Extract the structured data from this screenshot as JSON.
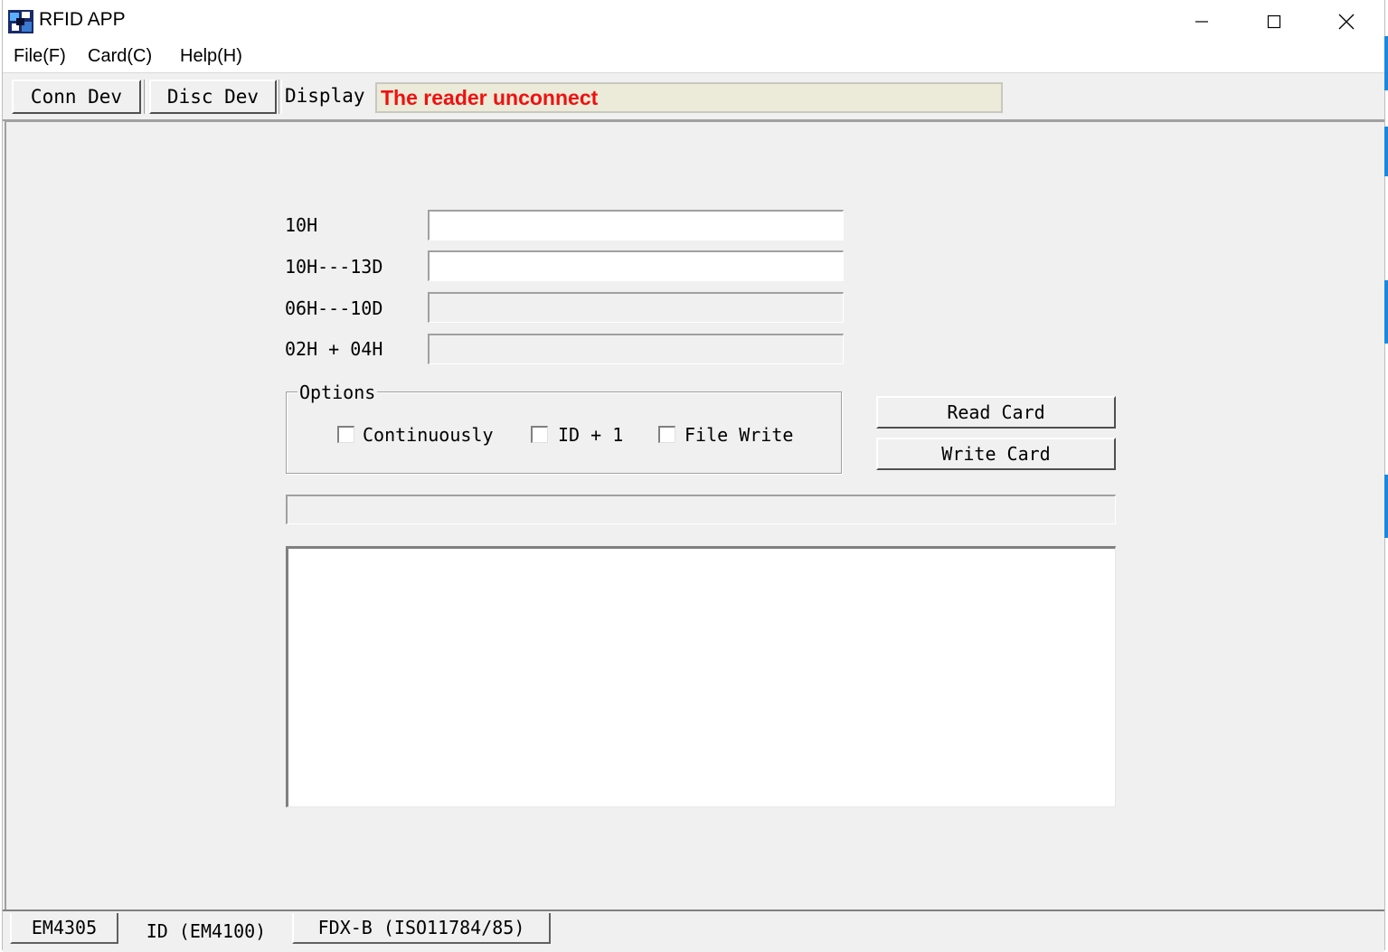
{
  "window": {
    "title": "RFID APP"
  },
  "menu": {
    "items": [
      "File(F)",
      "Card(C)",
      "Help(H)"
    ]
  },
  "toolbar": {
    "connect_label": "Conn Dev",
    "disconnect_label": "Disc Dev",
    "display_label": "Display",
    "status_text": "The reader unconnect"
  },
  "form": {
    "fields": [
      {
        "label": "10H",
        "value": ""
      },
      {
        "label": "10H---13D",
        "value": ""
      },
      {
        "label": "06H---10D",
        "value": ""
      },
      {
        "label": "02H + 04H",
        "value": ""
      }
    ],
    "options": {
      "title": "Options",
      "checkboxes": [
        {
          "label": "Continuously",
          "checked": false
        },
        {
          "label": "ID + 1",
          "checked": false
        },
        {
          "label": "File Write",
          "checked": false
        }
      ]
    },
    "read_button": "Read Card",
    "write_button": "Write Card"
  },
  "tabs": [
    {
      "label": "EM4305",
      "active": false
    },
    {
      "label": "ID (EM4100)",
      "active": true
    },
    {
      "label": "FDX-B (ISO11784/85)",
      "active": false
    }
  ]
}
